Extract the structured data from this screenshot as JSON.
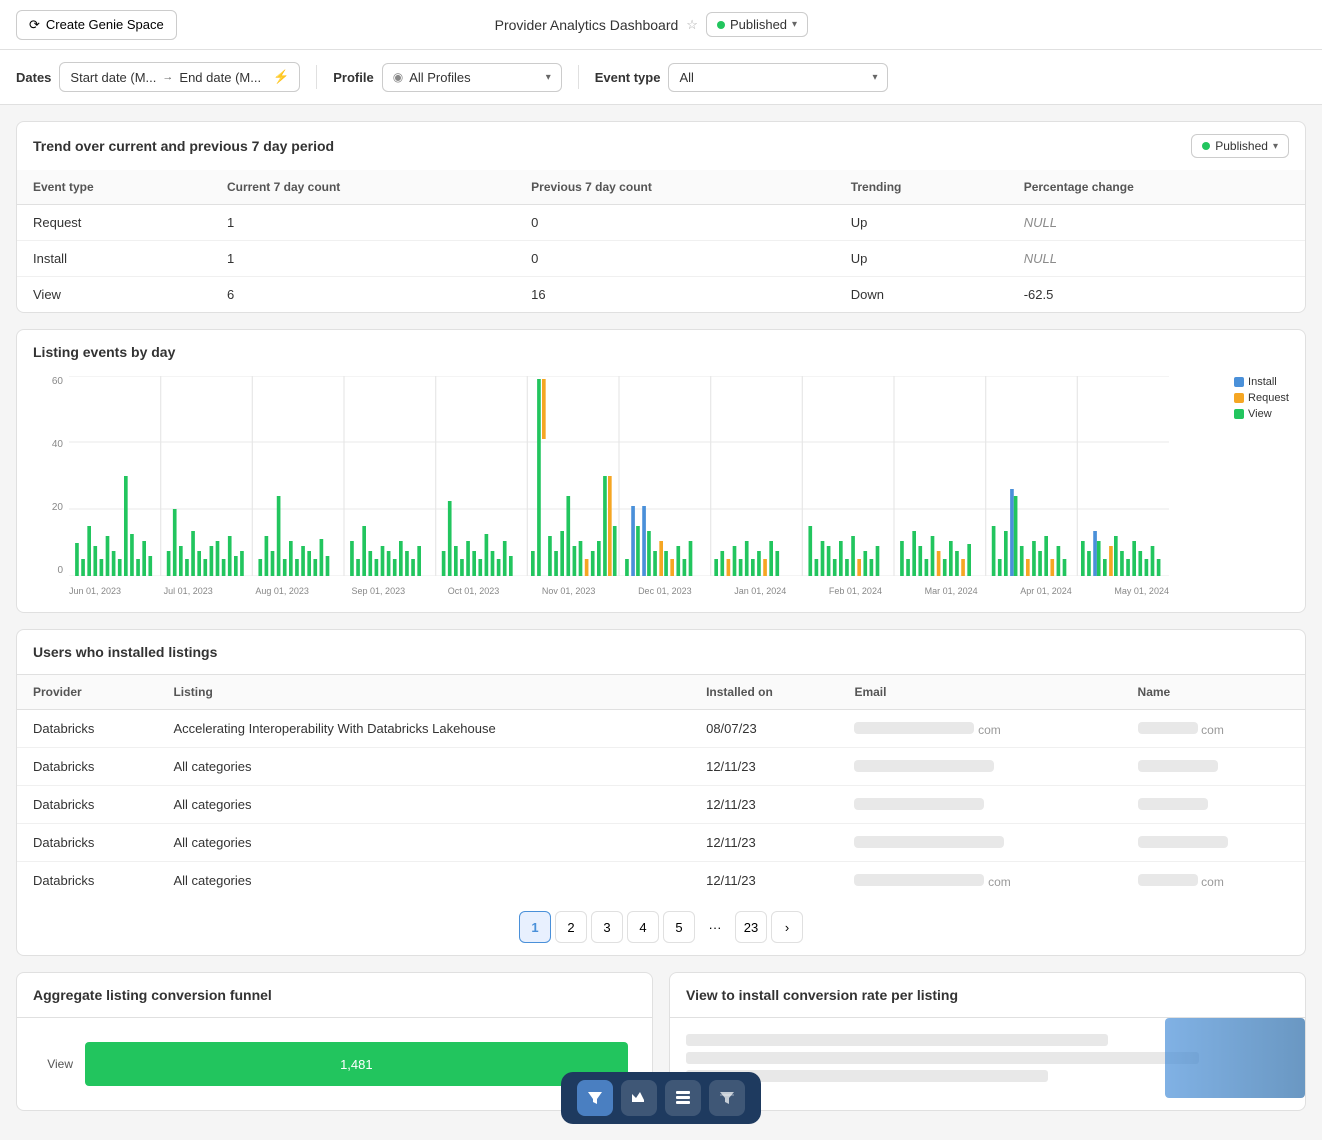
{
  "topNav": {
    "createBtn": "Create Genie Space",
    "title": "Provider Analytics Dashboard",
    "publishedLabel": "Published"
  },
  "filterBar": {
    "datesLabel": "Dates",
    "startDate": "Start date (M...",
    "endDate": "End date (M...",
    "profileLabel": "Profile",
    "profileValue": "All Profiles",
    "eventTypeLabel": "Event type",
    "eventTypeValue": "All"
  },
  "trendSection": {
    "title": "Trend over current and previous 7 day period",
    "publishedLabel": "Published",
    "columns": [
      "Event type",
      "Current 7 day count",
      "Previous 7 day count",
      "Trending",
      "Percentage change"
    ],
    "rows": [
      {
        "eventType": "Request",
        "current": "1",
        "previous": "0",
        "trending": "Up",
        "change": "NULL",
        "changeNull": true
      },
      {
        "eventType": "Install",
        "current": "1",
        "previous": "0",
        "trending": "Up",
        "change": "NULL",
        "changeNull": true
      },
      {
        "eventType": "View",
        "current": "6",
        "previous": "16",
        "trending": "Down",
        "change": "-62.5",
        "changeNull": false
      }
    ]
  },
  "listingChart": {
    "title": "Listing events by day",
    "yMax": 60,
    "yLabels": [
      "60",
      "40",
      "20",
      "0"
    ],
    "xLabels": [
      "Jun 01, 2023",
      "Jul 01, 2023",
      "Aug 01, 2023",
      "Sep 01, 2023",
      "Oct 01, 2023",
      "Nov 01, 2023",
      "Dec 01, 2023",
      "Jan 01, 2024",
      "Feb 01, 2024",
      "Mar 01, 2024",
      "Apr 01, 2024",
      "May 01, 2024"
    ],
    "legend": [
      {
        "label": "Install",
        "color": "#4a90d9"
      },
      {
        "label": "Request",
        "color": "#f5a623"
      },
      {
        "label": "View",
        "color": "#22c55e"
      }
    ]
  },
  "usersSection": {
    "title": "Users who installed listings",
    "columns": [
      "Provider",
      "Listing",
      "Installed on",
      "Email",
      "Name"
    ],
    "rows": [
      {
        "provider": "Databricks",
        "listing": "Accelerating Interoperability With Databricks Lakehouse",
        "installedOn": "08/07/23",
        "email": "blurred1",
        "name": "blurred1"
      },
      {
        "provider": "Databricks",
        "listing": "All categories",
        "installedOn": "12/11/23",
        "email": "blurred2",
        "name": "blurred2"
      },
      {
        "provider": "Databricks",
        "listing": "All categories",
        "installedOn": "12/11/23",
        "email": "blurred3",
        "name": "blurred3"
      },
      {
        "provider": "Databricks",
        "listing": "All categories",
        "installedOn": "12/11/23",
        "email": "blurred4",
        "name": "blurred4"
      },
      {
        "provider": "Databricks",
        "listing": "All categories",
        "installedOn": "12/11/23",
        "email": "blurred5",
        "name": "blurred5"
      }
    ],
    "pagination": {
      "current": 1,
      "pages": [
        "1",
        "2",
        "3",
        "4",
        "5",
        "...",
        "23"
      ],
      "nextLabel": "›"
    }
  },
  "aggregateFunnel": {
    "title": "Aggregate listing conversion funnel",
    "bars": [
      {
        "label": "View",
        "value": "1,481",
        "width": 90,
        "color": "#22c55e"
      }
    ]
  },
  "conversionRate": {
    "title": "View to install conversion rate per listing"
  },
  "toolbar": {
    "buttons": [
      {
        "icon": "filter",
        "label": "filter-icon",
        "active": true
      },
      {
        "icon": "chart",
        "label": "chart-icon",
        "active": false
      },
      {
        "icon": "table",
        "label": "table-icon",
        "active": false
      },
      {
        "icon": "funnel",
        "label": "funnel-icon",
        "active": false
      }
    ]
  }
}
